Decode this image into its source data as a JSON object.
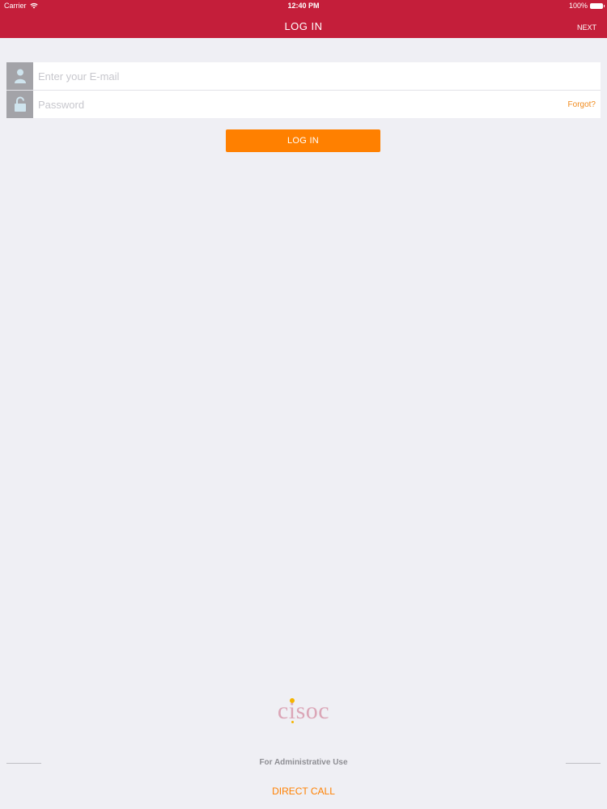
{
  "status_bar": {
    "carrier": "Carrier",
    "time": "12:40 PM",
    "battery": "100%"
  },
  "nav": {
    "title": "LOG IN",
    "next_label": "NEXT"
  },
  "form": {
    "email_placeholder": "Enter your E-mail",
    "password_placeholder": "Password",
    "forgot_label": "Forgot?"
  },
  "login_button_label": "LOG IN",
  "logo": {
    "part1": "c",
    "part2": "i",
    "part3": "soc"
  },
  "footer": {
    "admin_label": "For Administrative Use",
    "direct_call_label": "DIRECT CALL"
  },
  "colors": {
    "brand_red": "#c41e3a",
    "accent_orange": "#ff8000",
    "icon_grey": "#a3a3a8",
    "background": "#efeff4"
  }
}
